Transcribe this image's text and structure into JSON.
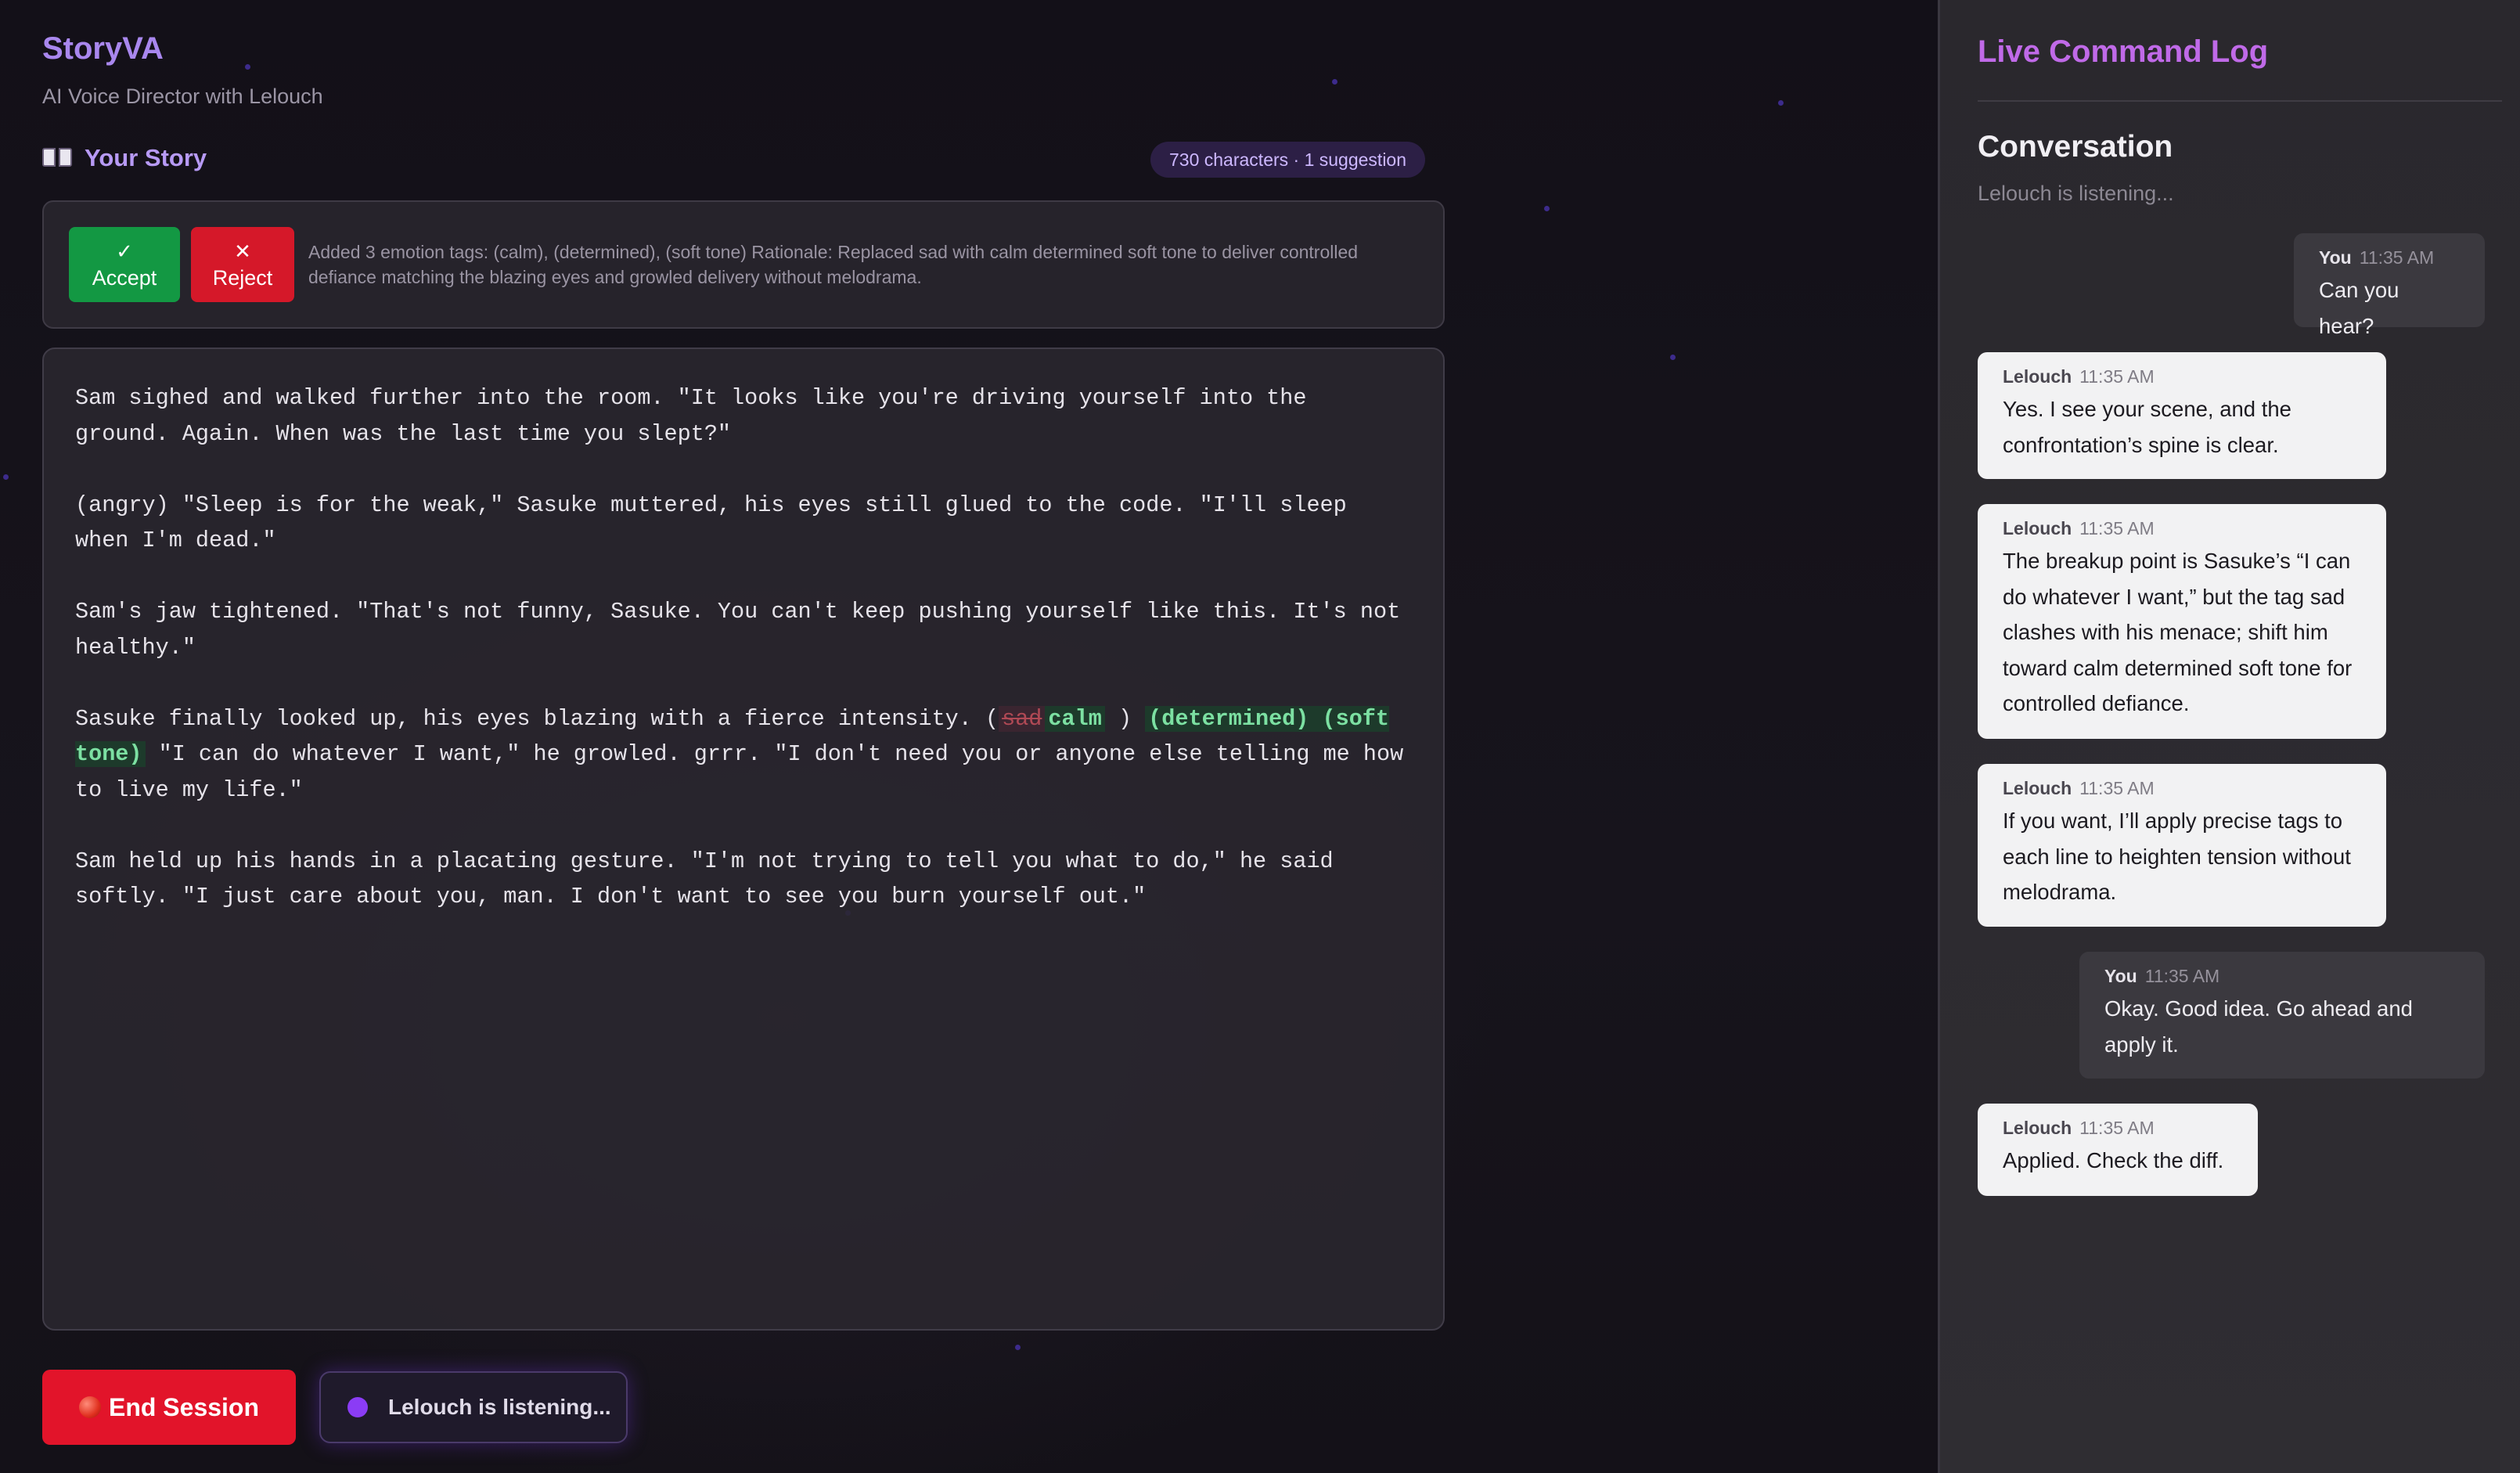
{
  "app": {
    "title": "StoryVA",
    "subtitle": "AI Voice Director with Lelouch"
  },
  "story": {
    "label": "Your Story",
    "stats": "730 characters · 1 suggestion"
  },
  "suggestion": {
    "accept_label": "Accept",
    "reject_label": "Reject",
    "text": "Added 3 emotion tags: (calm), (determined), (soft tone) Rationale: Replaced sad with calm determined soft tone to deliver controlled defiance matching the blazing eyes and growled delivery without melodrama."
  },
  "editor": {
    "p1": "Sam sighed and walked further into the room. \"It looks like you're driving yourself into the ground. Again. When was the last time you slept?\"",
    "p2": "(angry) \"Sleep is for the weak,\" Sasuke muttered, his eyes still glued to the code. \"I'll sleep when I'm dead.\"",
    "p3": "Sam's jaw tightened. \"That's not funny, Sasuke. You can't keep pushing yourself like this. It's not healthy.\"",
    "p4_before": "Sasuke finally looked up, his eyes blazing with a fierce intensity. (",
    "p4_deleted": "sad",
    "p4_inserted": "calm",
    "p4_close": ")",
    "p4_added_tags": "(determined) (soft tone)",
    "p4_after": "\"I can do whatever I want,\" he growled. grrr. \"I don't need you or anyone else telling me how to live my life.\"",
    "p5": "Sam held up his hands in a placating gesture. \"I'm not trying to tell you what to do,\" he said softly. \"I just care about you, man. I don't want to see you burn yourself out.\""
  },
  "controls": {
    "end_session_label": "End Session",
    "listening_label": "Lelouch is listening..."
  },
  "log": {
    "title": "Live Command Log",
    "conversation_title": "Conversation",
    "status": "Lelouch is listening...",
    "messages": [
      {
        "sender": "You",
        "time": "11:35 AM",
        "text": "Can you hear?"
      },
      {
        "sender": "Lelouch",
        "time": "11:35 AM",
        "text": "Yes. I see your scene, and the confrontation’s spine is clear."
      },
      {
        "sender": "Lelouch",
        "time": "11:35 AM",
        "text": "The breakup point is Sasuke’s “I can do whatever I want,” but the tag sad clashes with his menace; shift him toward calm determined soft tone for controlled defiance."
      },
      {
        "sender": "Lelouch",
        "time": "11:35 AM",
        "text": "If you want, I’ll apply precise tags to each line to heighten tension without melodrama."
      },
      {
        "sender": "You",
        "time": "11:35 AM",
        "text": "Okay. Good idea. Go ahead and apply it."
      },
      {
        "sender": "Lelouch",
        "time": "11:35 AM",
        "text": "Applied. Check the diff."
      }
    ]
  },
  "colors": {
    "accent_purple": "#a987ee",
    "accept_green": "#139843",
    "reject_red": "#d51829",
    "end_session_red": "#e2142a",
    "log_title_magenta": "#c06ae8"
  }
}
